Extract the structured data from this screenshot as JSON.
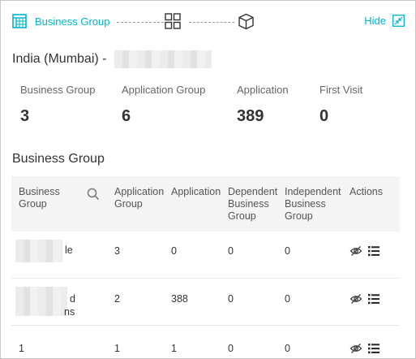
{
  "steps": {
    "current_label": "Business Group",
    "step_icons": [
      "business-group-icon",
      "application-group-icon",
      "application-icon"
    ],
    "hide_label": "Hide",
    "accent_color": "#00b4cc"
  },
  "region": {
    "title": "India (Mumbai) -"
  },
  "stats": [
    {
      "label": "Business Group",
      "value": "3"
    },
    {
      "label": "Application Group",
      "value": "6"
    },
    {
      "label": "Application",
      "value": "389"
    },
    {
      "label": "First Visit",
      "value": "0"
    }
  ],
  "section_title": "Business Group",
  "table": {
    "headers": {
      "business_group": "Business Group",
      "application_group": "Application Group",
      "application": "Application",
      "dependent": "Dependent Business Group",
      "independent": "Independent Business Group",
      "actions": "Actions"
    },
    "rows": [
      {
        "name_tail": "le",
        "application_group": "3",
        "application": "0",
        "dependent": "0",
        "independent": "0"
      },
      {
        "name_tail_1": "d",
        "name_tail_2": "ns",
        "application_group": "2",
        "application": "388",
        "dependent": "0",
        "independent": "0"
      },
      {
        "name": "1",
        "application_group": "1",
        "application": "1",
        "dependent": "0",
        "independent": "0"
      }
    ]
  }
}
